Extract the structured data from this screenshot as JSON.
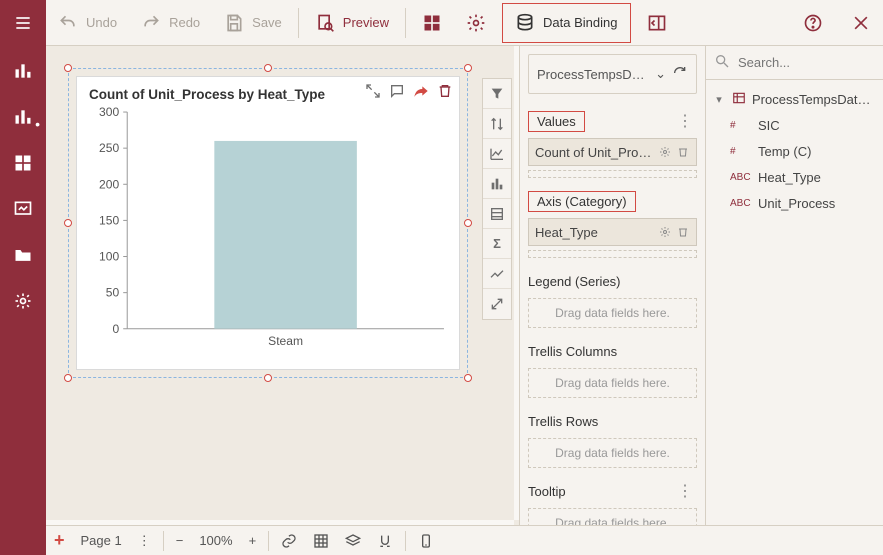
{
  "toolbar": {
    "undo": "Undo",
    "redo": "Redo",
    "save": "Save",
    "preview": "Preview",
    "data_binding": "Data Binding"
  },
  "dataset": {
    "name": "ProcessTempsDataset",
    "search_placeholder": "Search...",
    "root": "ProcessTempsDat…",
    "fields": [
      {
        "type": "#",
        "name": "SIC"
      },
      {
        "type": "#",
        "name": "Temp (C)"
      },
      {
        "type": "ABC",
        "name": "Heat_Type"
      },
      {
        "type": "ABC",
        "name": "Unit_Process"
      }
    ]
  },
  "binding": {
    "values_title": "Values",
    "values_item": "Count of Unit_Proc…",
    "axis_title": "Axis (Category)",
    "axis_item": "Heat_Type",
    "legend_title": "Legend (Series)",
    "trellis_cols_title": "Trellis Columns",
    "trellis_rows_title": "Trellis Rows",
    "tooltip_title": "Tooltip",
    "drop_hint": "Drag data fields here."
  },
  "chart": {
    "title": "Count of Unit_Process by Heat_Type"
  },
  "chart_data": {
    "type": "bar",
    "categories": [
      "Steam"
    ],
    "values": [
      260
    ],
    "title": "Count of Unit_Process by Heat_Type",
    "xlabel": "",
    "ylabel": "",
    "ylim": [
      0,
      300
    ],
    "yticks": [
      0,
      50,
      100,
      150,
      200,
      250,
      300
    ]
  },
  "bottom": {
    "page": "Page 1",
    "zoom": "100%"
  }
}
